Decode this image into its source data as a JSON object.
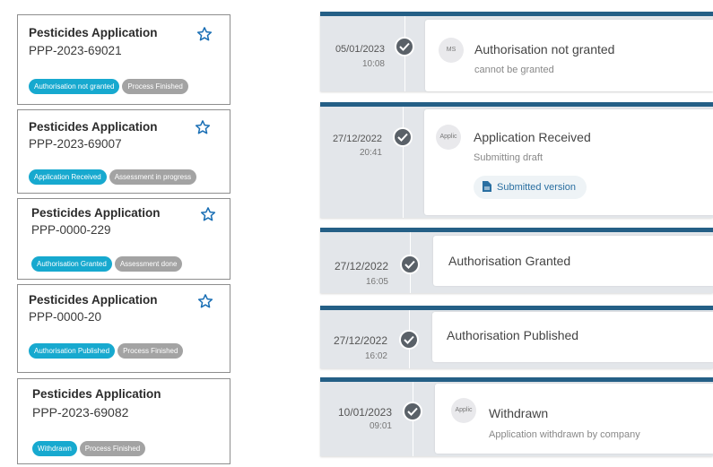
{
  "applications": [
    {
      "title": "Pesticides Application",
      "code": "PPP-2023-69021",
      "status": "Authorisation not granted",
      "process": "Process Finished"
    },
    {
      "title": "Pesticides Application",
      "code": "PPP-2023-69007",
      "status": "Application Received",
      "process": "Assessment in progress"
    },
    {
      "title": "Pesticides Application",
      "code": "PPP-0000-229",
      "status": "Authorisation Granted",
      "process": "Assessment done"
    },
    {
      "title": "Pesticides Application",
      "code": "PPP-0000-20",
      "status": "Authorisation Published",
      "process": "Process Finished"
    },
    {
      "title": "Pesticides Application",
      "code": "PPP-2023-69082",
      "status": "Withdrawn",
      "process": "Process Finished"
    }
  ],
  "timeline": [
    {
      "date": "05/01/2023",
      "time": "10:08",
      "avatar": "MS",
      "title": "Authorisation not granted",
      "subtitle": "cannot be granted"
    },
    {
      "date": "27/12/2022",
      "time": "20:41",
      "avatar": "Applic",
      "title": "Application Received",
      "subtitle": "Submitting draft",
      "document": "Submitted version"
    },
    {
      "date": "27/12/2022",
      "time": "16:05",
      "title": "Authorisation Granted"
    },
    {
      "date": "27/12/2022",
      "time": "16:02",
      "title": "Authorisation Published"
    },
    {
      "date": "10/01/2023",
      "time": "09:01",
      "avatar": "Applic",
      "title": "Withdrawn",
      "subtitle": "Application withdrawn by company"
    }
  ],
  "icons": {
    "favorite": "star-outline-icon",
    "done": "check-circle-icon",
    "document": "document-icon"
  },
  "colors": {
    "status_badge": "#17a9cf",
    "process_badge": "#a3a3a3",
    "timeline_accent": "#245f86",
    "check": "#5a6168",
    "star": "#1a6fb5"
  }
}
